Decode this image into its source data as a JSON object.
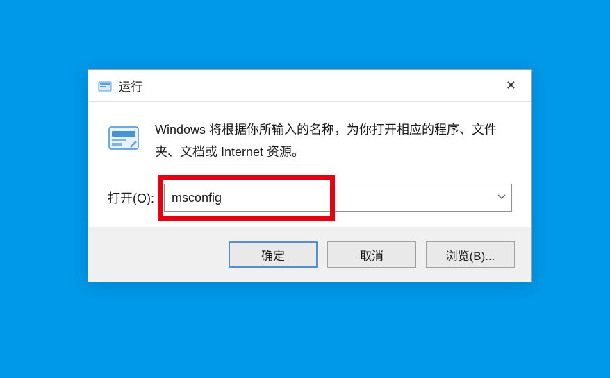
{
  "dialog": {
    "title": "运行",
    "description": "Windows 将根据你所输入的名称，为你打开相应的程序、文件夹、文档或 Internet 资源。",
    "input_label": "打开(O):",
    "input_value": "msconfig",
    "buttons": {
      "ok": "确定",
      "cancel": "取消",
      "browse": "浏览(B)..."
    }
  }
}
